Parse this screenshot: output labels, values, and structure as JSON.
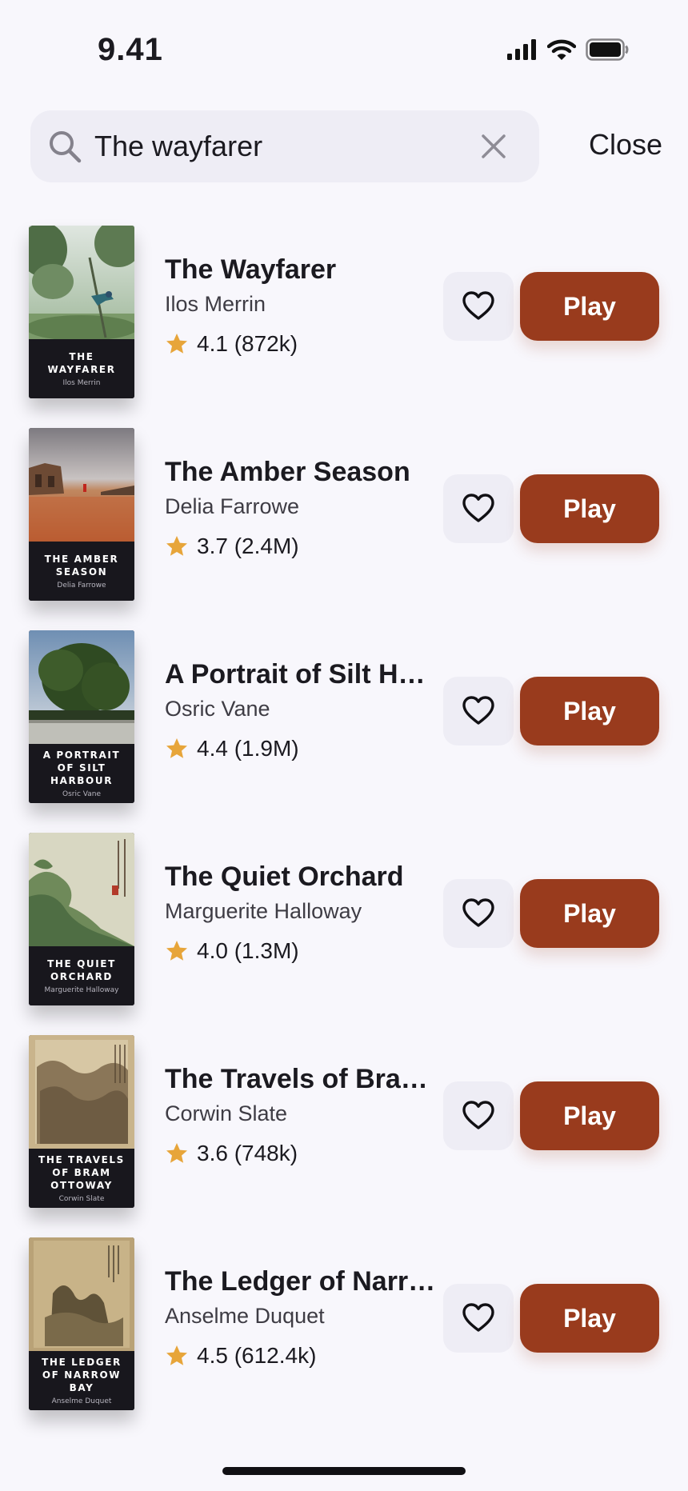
{
  "status_bar": {
    "time": "9.41",
    "icons": [
      "cellular-signal-icon",
      "wifi-icon",
      "battery-icon"
    ]
  },
  "search": {
    "value": "The wayfarer",
    "placeholder": "Search",
    "close_label": "Close"
  },
  "buttons": {
    "play_label": "Play"
  },
  "colors": {
    "background": "#f8f7fc",
    "search_field": "#eeedf5",
    "play_button": "#993b1d",
    "star": "#e7a53a",
    "cover_label": "#18171d"
  },
  "results": [
    {
      "title": "The Wayfarer",
      "author": "Ilos Merrin",
      "rating": "4.1",
      "ratings_count": "(872k)",
      "rating_text": "4.1 (872k)",
      "cover_title": "THE WAYFARER",
      "cover_author": "Ilos Merrin"
    },
    {
      "title": "The Amber Season",
      "author": "Delia Farrowe",
      "rating": "3.7",
      "ratings_count": "(2.4M)",
      "rating_text": "3.7 (2.4M)",
      "cover_title": "THE AMBER SEASON",
      "cover_author": "Delia Farrowe"
    },
    {
      "title": "A Portrait of Silt Har...",
      "author": "Osric Vane",
      "rating": "4.4",
      "ratings_count": "(1.9M)",
      "rating_text": "4.4 (1.9M)",
      "cover_title": "A PORTRAIT OF SILT HARBOUR",
      "cover_author": "Osric Vane"
    },
    {
      "title": "The Quiet Orchard",
      "author": "Marguerite Halloway",
      "rating": "4.0",
      "ratings_count": "(1.3M)",
      "rating_text": "4.0 (1.3M)",
      "cover_title": "THE QUIET ORCHARD",
      "cover_author": "Marguerite Halloway"
    },
    {
      "title": "The Travels of Bram ...",
      "author": "Corwin Slate",
      "rating": "3.6",
      "ratings_count": "(748k)",
      "rating_text": "3.6 (748k)",
      "cover_title": "THE TRAVELS OF BRAM OTTOWAY",
      "cover_author": "Corwin Slate"
    },
    {
      "title": "The Ledger of Narro...",
      "author": "Anselme Duquet",
      "rating": "4.5",
      "ratings_count": "(612.4k)",
      "rating_text": "4.5 (612.4k)",
      "cover_title": "THE LEDGER OF NARROW BAY",
      "cover_author": "Anselme Duquet"
    }
  ]
}
